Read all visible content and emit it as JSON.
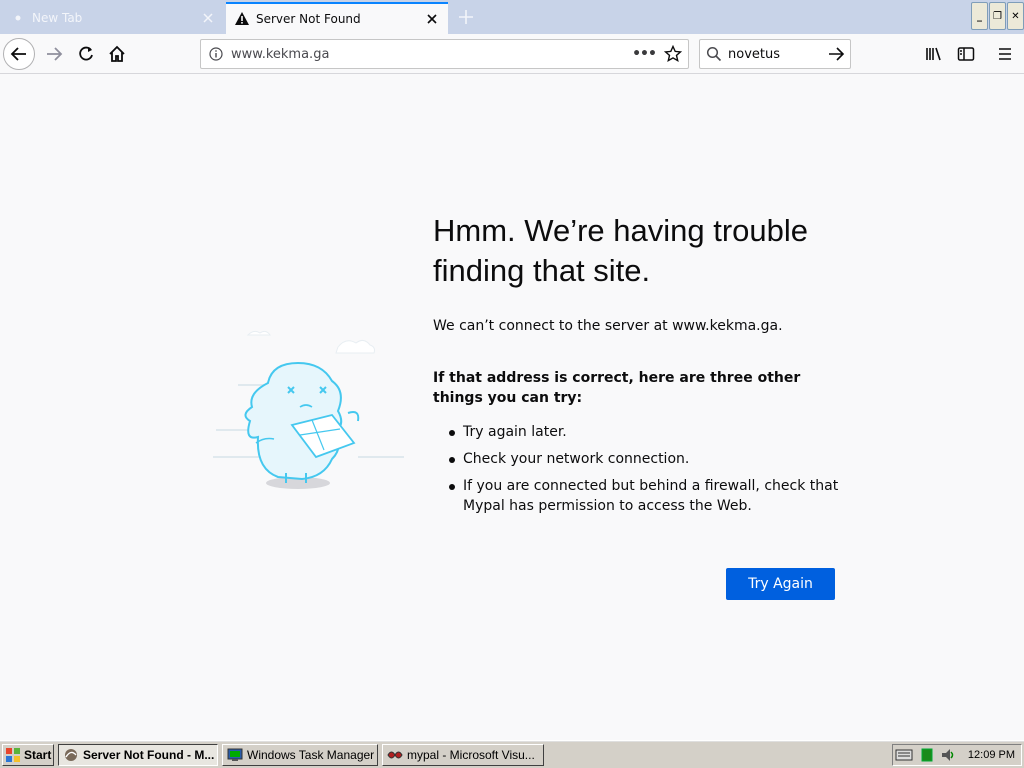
{
  "tabs": [
    {
      "label": "New Tab",
      "active": false
    },
    {
      "label": "Server Not Found",
      "active": true
    }
  ],
  "window_controls": {
    "minimize": "_",
    "restore": "❐",
    "close": "✕"
  },
  "navbar": {
    "url": "www.kekma.ga",
    "page_actions": "•••",
    "search_value": "novetus"
  },
  "error": {
    "title": "Hmm. We’re having trouble finding that site.",
    "description": "We can’t connect to the server at www.kekma.ga.",
    "suggestions_heading": "If that address is correct, here are three other things you can try:",
    "suggestions": [
      "Try again later.",
      "Check your network connection.",
      "If you are connected but behind a firewall, check that Mypal has permission to access the Web."
    ],
    "button": "Try Again"
  },
  "taskbar": {
    "start": "Start",
    "tasks": [
      {
        "label": "Server Not Found - M...",
        "active": true
      },
      {
        "label": "Windows Task Manager",
        "active": false
      },
      {
        "label": "mypal - Microsoft Visu...",
        "active": false
      }
    ],
    "clock": "12:09 PM"
  },
  "colors": {
    "accent": "#0a84ff",
    "button": "#0060df",
    "illustration": "#45c8ef"
  }
}
